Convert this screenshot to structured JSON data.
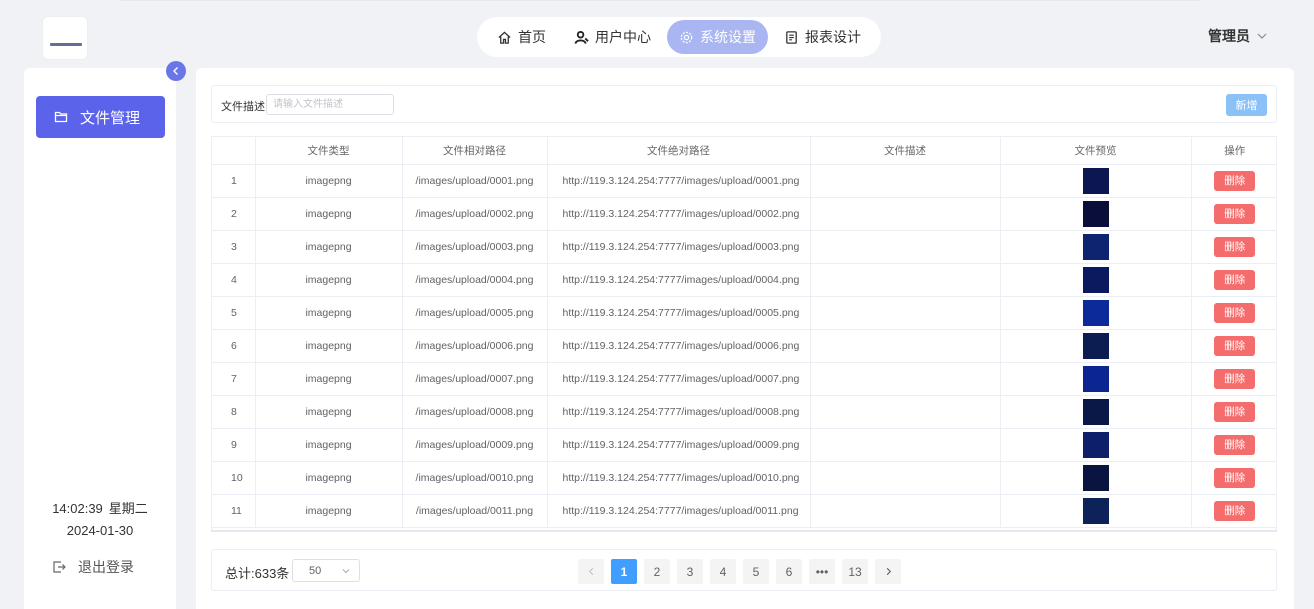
{
  "nav": {
    "items": [
      {
        "label": "首页",
        "icon": "home-icon",
        "active": false
      },
      {
        "label": "用户中心",
        "icon": "user-icon",
        "active": false
      },
      {
        "label": "系统设置",
        "icon": "gear-icon",
        "active": true
      },
      {
        "label": "报表设计",
        "icon": "document-icon",
        "active": false
      }
    ],
    "user_label": "管理员"
  },
  "sidebar": {
    "menu_label": "文件管理",
    "time": "14:02:39",
    "weekday": "星期二",
    "date": "2024-01-30",
    "logout_label": "退出登录"
  },
  "search": {
    "label": "文件描述",
    "placeholder": "请输入文件描述",
    "add_label": "新增"
  },
  "table": {
    "headers": [
      "",
      "文件类型",
      "文件相对路径",
      "文件绝对路径",
      "文件描述",
      "文件预览",
      "操作"
    ],
    "delete_label": "删除",
    "rows": [
      {
        "no": "1",
        "type": "imagepng",
        "rel": "/images/upload/0001.png",
        "abs": "http://119.3.124.254:7777/images/upload/0001.png",
        "desc": "",
        "thumb": "#0c1650"
      },
      {
        "no": "2",
        "type": "imagepng",
        "rel": "/images/upload/0002.png",
        "abs": "http://119.3.124.254:7777/images/upload/0002.png",
        "desc": "",
        "thumb": "#0a0f3a"
      },
      {
        "no": "3",
        "type": "imagepng",
        "rel": "/images/upload/0003.png",
        "abs": "http://119.3.124.254:7777/images/upload/0003.png",
        "desc": "",
        "thumb": "#0e2470"
      },
      {
        "no": "4",
        "type": "imagepng",
        "rel": "/images/upload/0004.png",
        "abs": "http://119.3.124.254:7777/images/upload/0004.png",
        "desc": "",
        "thumb": "#0b1a5e"
      },
      {
        "no": "5",
        "type": "imagepng",
        "rel": "/images/upload/0005.png",
        "abs": "http://119.3.124.254:7777/images/upload/0005.png",
        "desc": "",
        "thumb": "#0d2a9a"
      },
      {
        "no": "6",
        "type": "imagepng",
        "rel": "/images/upload/0006.png",
        "abs": "http://119.3.124.254:7777/images/upload/0006.png",
        "desc": "",
        "thumb": "#0c1d52"
      },
      {
        "no": "7",
        "type": "imagepng",
        "rel": "/images/upload/0007.png",
        "abs": "http://119.3.124.254:7777/images/upload/0007.png",
        "desc": "",
        "thumb": "#0b2690"
      },
      {
        "no": "8",
        "type": "imagepng",
        "rel": "/images/upload/0008.png",
        "abs": "http://119.3.124.254:7777/images/upload/0008.png",
        "desc": "",
        "thumb": "#0a1848"
      },
      {
        "no": "9",
        "type": "imagepng",
        "rel": "/images/upload/0009.png",
        "abs": "http://119.3.124.254:7777/images/upload/0009.png",
        "desc": "",
        "thumb": "#0e1f6a"
      },
      {
        "no": "10",
        "type": "imagepng",
        "rel": "/images/upload/0010.png",
        "abs": "http://119.3.124.254:7777/images/upload/0010.png",
        "desc": "",
        "thumb": "#0a1440"
      },
      {
        "no": "11",
        "type": "imagepng",
        "rel": "/images/upload/0011.png",
        "abs": "http://119.3.124.254:7777/images/upload/0011.png",
        "desc": "",
        "thumb": "#0c2258"
      }
    ]
  },
  "pagination": {
    "total_label": "总计:633条",
    "page_size": "50",
    "pages": [
      "1",
      "2",
      "3",
      "4",
      "5",
      "6",
      "•••",
      "13"
    ],
    "current": "1"
  },
  "colors": {
    "primary": "#5b63ea",
    "nav_active": "#a9b6f2",
    "delete": "#f56c6c",
    "add": "#8bc1f7",
    "page_active": "#409eff"
  }
}
